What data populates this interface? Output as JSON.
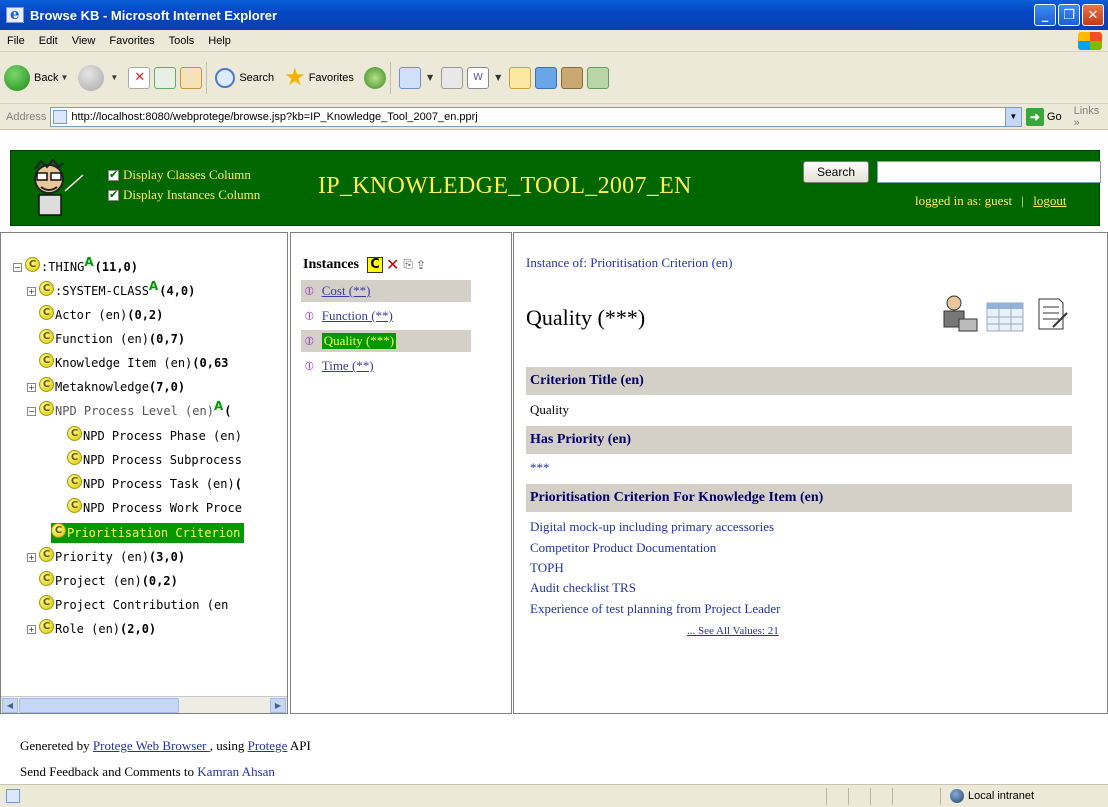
{
  "window": {
    "title": "Browse KB - Microsoft Internet Explorer",
    "buttons": [
      "minimize",
      "maximize",
      "close"
    ]
  },
  "menubar": [
    "File",
    "Edit",
    "View",
    "Favorites",
    "Tools",
    "Help"
  ],
  "toolbar": {
    "back_label": "Back",
    "search_label": "Search",
    "favorites_label": "Favorites"
  },
  "addressbar": {
    "label": "Address",
    "url": "http://localhost:8080/webprotege/browse.jsp?kb=IP_Knowledge_Tool_2007_en.pprj",
    "go_label": "Go",
    "links_label": "Links »"
  },
  "header": {
    "display_classes": "Display Classes Column",
    "display_instances": "Display Instances Column",
    "kb_title": "IP_KNOWLEDGE_TOOL_2007_EN",
    "search_button": "Search",
    "logged_in": "logged in as: guest",
    "separator": "|",
    "logout": "logout"
  },
  "class_tree": [
    {
      "toggle": "⊟",
      "name": ":THING",
      "abstract": "A",
      "count": "(11,0)"
    },
    {
      "toggle": "⊞",
      "name": ":SYSTEM-CLASS",
      "abstract": "A",
      "count": "(4,0)"
    },
    {
      "toggle": "",
      "name": "Actor (en)",
      "abstract": "",
      "count": "(0,2)"
    },
    {
      "toggle": "",
      "name": "Function (en)",
      "abstract": "",
      "count": "(0,7)"
    },
    {
      "toggle": "",
      "name": "Knowledge Item (en)",
      "abstract": "",
      "count": "(0,63"
    },
    {
      "toggle": "⊞",
      "name": "Metaknowledge",
      "abstract": "",
      "count": "(7,0)"
    },
    {
      "toggle": "⊟",
      "name": "NPD Process Level (en)",
      "abstract": "A",
      "count": "("
    },
    {
      "toggle": "",
      "name": "NPD Process Phase (en)",
      "abstract": "",
      "count": ""
    },
    {
      "toggle": "",
      "name": "NPD Process Subprocess",
      "abstract": "",
      "count": ""
    },
    {
      "toggle": "",
      "name": "NPD Process Task (en)",
      "abstract": "",
      "count": "("
    },
    {
      "toggle": "",
      "name": "NPD Process Work Proce",
      "abstract": "",
      "count": ""
    },
    {
      "toggle": "",
      "name": "Prioritisation Criterion",
      "abstract": "",
      "count": ""
    },
    {
      "toggle": "⊞",
      "name": "Priority (en)",
      "abstract": "",
      "count": "(3,0)"
    },
    {
      "toggle": "",
      "name": "Project (en)",
      "abstract": "",
      "count": "(0,2)"
    },
    {
      "toggle": "",
      "name": "Project Contribution (en",
      "abstract": "",
      "count": ""
    },
    {
      "toggle": "⊞",
      "name": "Role (en)",
      "abstract": "",
      "count": "(2,0)"
    }
  ],
  "class_icon_letter": "C",
  "instances": {
    "title": "Instances",
    "create_label": "C",
    "delete_label": "✕",
    "items": [
      "Cost (**)",
      "Function (**)",
      "Quality (***)",
      "Time (**)"
    ]
  },
  "detail": {
    "instance_of": "Instance of: Prioritisation Criterion (en)",
    "name": "Quality (***)",
    "slots": [
      {
        "title": "Criterion Title (en)",
        "value": "Quality"
      },
      {
        "title": "Has Priority (en)",
        "value": "***"
      },
      {
        "title": "Prioritisation Criterion For Knowledge Item (en)",
        "value": ""
      }
    ],
    "knowledge_items": [
      "Digital mock-up including primary accessories",
      "Competitor Product Documentation",
      "TOPH",
      "Audit checklist TRS",
      "Experience of test planning from Project Leader"
    ],
    "see_all": "... See All Values: 21"
  },
  "footer": {
    "generated_prefix": "Genereted by ",
    "browser_link": "Protege Web Browser ",
    "using": ", using ",
    "protege_link": "Protege",
    "api": " API",
    "feedback_prefix": "Send Feedback and Comments to ",
    "author": "Kamran Ahsan"
  },
  "statusbar": {
    "zone": "Local intranet"
  },
  "colors": {
    "header_green": "#006600",
    "selection_green": "#009900",
    "header_text_yellow": "#ffee55",
    "slot_header_gray": "#d4d0c8",
    "link_blue": "#2233aa"
  }
}
